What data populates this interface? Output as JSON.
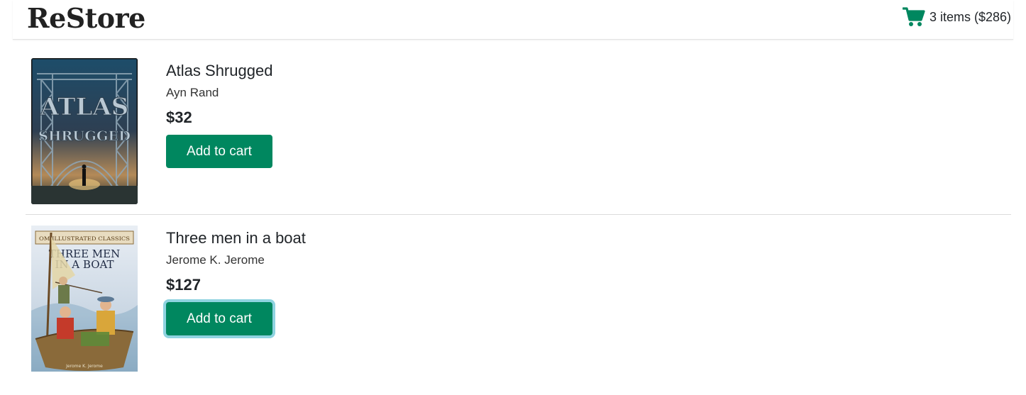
{
  "header": {
    "brand": "ReStore",
    "cart_icon": "shopping-cart-icon",
    "cart_summary": "3 items ($286)",
    "accent_color": "#00875f"
  },
  "products": [
    {
      "title": "Atlas Shrugged",
      "author": "Ayn Rand",
      "price": "$32",
      "button_label": "Add to cart",
      "cover_text": [
        "ATLAS",
        "SHRUGGED"
      ]
    },
    {
      "title": "Three men in a boat",
      "author": "Jerome K. Jerome",
      "price": "$127",
      "button_label": "Add to cart",
      "cover_text": [
        "OM ILLUSTRATED CLASSICS",
        "THREE MEN",
        "IN A BOAT",
        "Jerome K. Jerome"
      ]
    }
  ]
}
